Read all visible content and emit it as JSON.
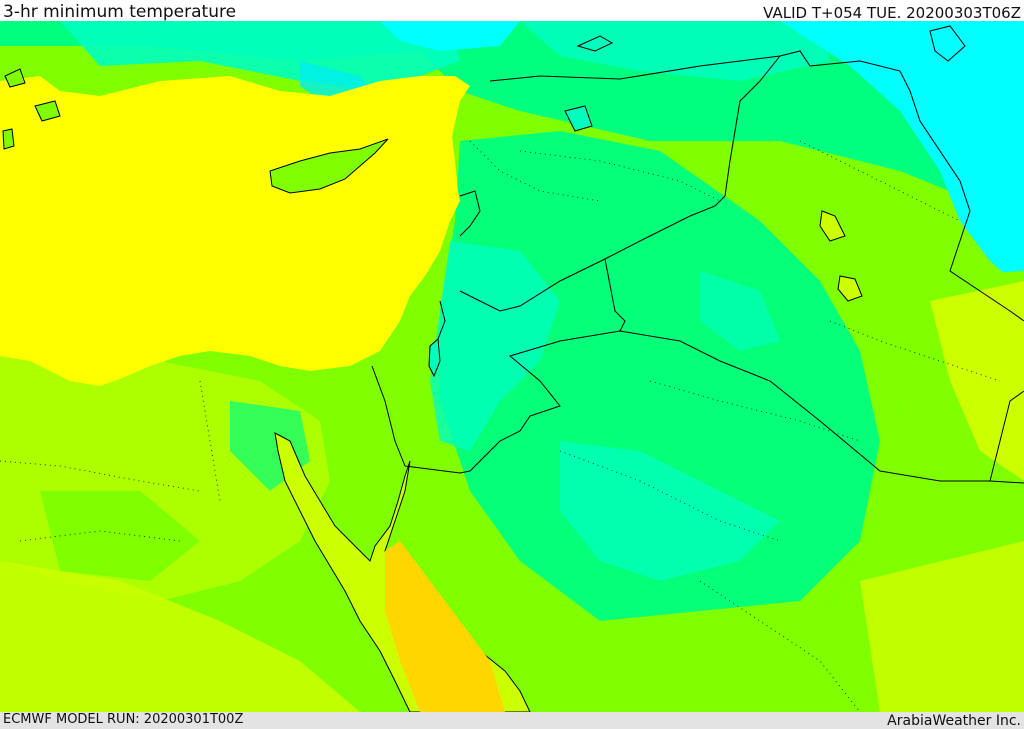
{
  "header": {
    "title": "3-hr minimum temperature",
    "valid": "VALID T+054 TUE. 20200303T06Z"
  },
  "footer": {
    "model_run": "ECMWF MODEL RUN: 20200301T00Z",
    "credit": "ArabiaWeather Inc."
  },
  "map": {
    "colors": {
      "sea_yellow": "#ffff00",
      "lime": "#7fff00",
      "yellow_green": "#ccff00",
      "green": "#00ff7f",
      "teal": "#00ffbf",
      "cyan": "#00ffff",
      "aqua": "#00efef",
      "gold": "#ffd700",
      "border": "#000000"
    }
  }
}
